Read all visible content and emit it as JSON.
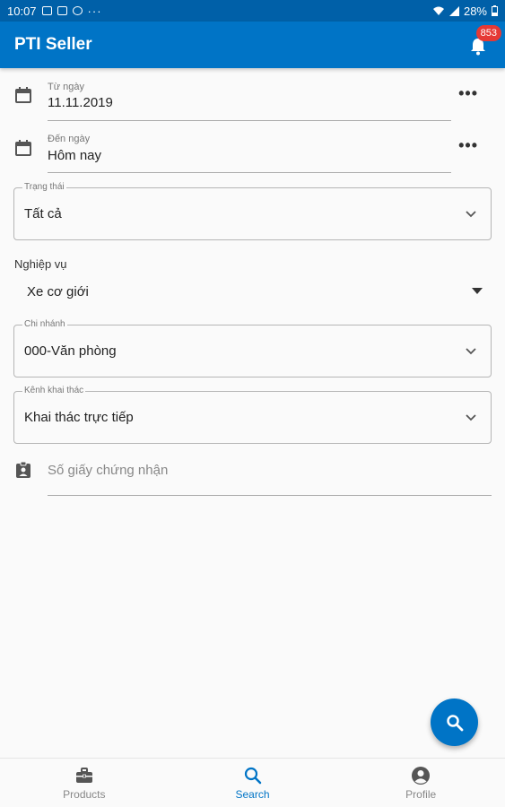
{
  "statusbar": {
    "time": "10:07",
    "extra": "···",
    "battery": "28%"
  },
  "appbar": {
    "title": "PTI Seller",
    "notification_count": "853"
  },
  "from_date": {
    "label": "Từ ngày",
    "value": "11.11.2019"
  },
  "to_date": {
    "label": "Đến ngày",
    "value": "Hôm nay"
  },
  "status_field": {
    "legend": "Trạng thái",
    "value": "Tất cả"
  },
  "business": {
    "label": "Nghiệp vụ",
    "value": "Xe cơ giới"
  },
  "branch_field": {
    "legend": "Chi nhánh",
    "value": "000-Văn phòng"
  },
  "channel_field": {
    "legend": "Kênh khai thác",
    "value": "Khai thác trực tiếp"
  },
  "certificate": {
    "placeholder": "Số giấy chứng nhận"
  },
  "more_label": "•••",
  "colors": {
    "primary": "#0074c6",
    "statusbar": "#0060a8",
    "badge": "#e53935"
  },
  "nav": {
    "items": [
      {
        "label": "Products",
        "icon": "briefcase-icon"
      },
      {
        "label": "Search",
        "icon": "search-icon"
      },
      {
        "label": "Profile",
        "icon": "account-circle-icon"
      }
    ]
  }
}
